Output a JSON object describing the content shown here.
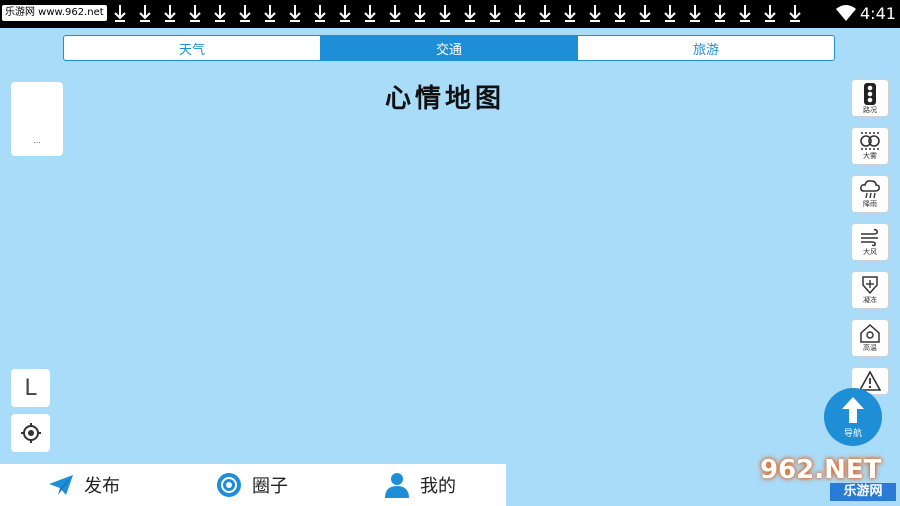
{
  "status_bar": {
    "watermark": "乐游网 www.962.net",
    "time": "4:41",
    "download_icons": [
      "download-icon",
      "download-icon",
      "download-icon",
      "download-icon",
      "download-icon",
      "download-icon",
      "download-icon",
      "download-icon",
      "download-icon",
      "download-icon",
      "download-icon",
      "download-icon",
      "download-icon",
      "download-icon",
      "download-icon",
      "download-icon",
      "download-icon",
      "download-icon",
      "download-icon",
      "download-icon",
      "download-icon",
      "download-icon",
      "download-icon",
      "download-icon",
      "download-icon",
      "download-icon",
      "download-icon",
      "download-icon"
    ]
  },
  "tabs": [
    {
      "label": "天气",
      "active": false
    },
    {
      "label": "交通",
      "active": true
    },
    {
      "label": "旅游",
      "active": false
    }
  ],
  "title": "心情地图",
  "left_panel": {
    "card_text": "...",
    "layer_button": "L",
    "locate_icon": "locate-icon"
  },
  "right_panel": {
    "items": [
      {
        "label": "路况",
        "icon": "traffic-light-icon"
      },
      {
        "label": "大雾",
        "icon": "fog-icon"
      },
      {
        "label": "降雨",
        "icon": "rain-icon"
      },
      {
        "label": "大风",
        "icon": "wind-icon"
      },
      {
        "label": "凝冻",
        "icon": "freeze-icon"
      },
      {
        "label": "高温",
        "icon": "heat-icon"
      },
      {
        "label": "",
        "icon": "warning-icon"
      }
    ],
    "nav_label": "导航"
  },
  "bottom_bar": {
    "items": [
      {
        "label": "发布",
        "icon": "paper-plane-icon"
      },
      {
        "label": "圈子",
        "icon": "circle-icon"
      },
      {
        "label": "我的",
        "icon": "person-icon"
      }
    ]
  },
  "logo": {
    "text_main": "962.NET",
    "text_sub": "乐游网"
  },
  "colors": {
    "accent": "#1e8fd6",
    "map_background": "#a9dcf9"
  }
}
